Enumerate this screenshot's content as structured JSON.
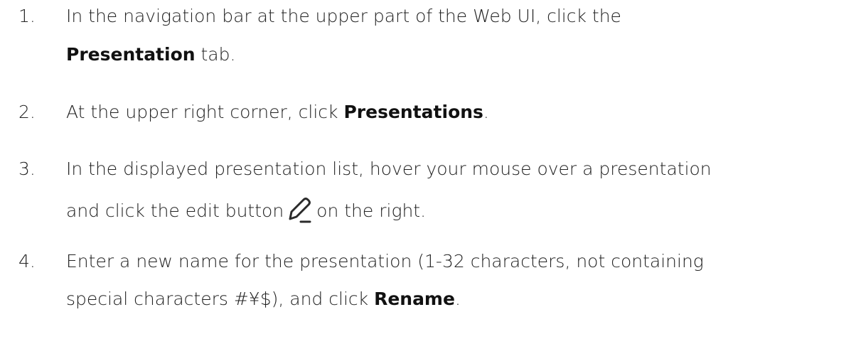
{
  "steps": [
    {
      "number": "1.",
      "text_a": "In the navigation bar at the upper part of the Web UI, click the",
      "bold_1": "Presentation",
      "text_b": " tab."
    },
    {
      "number": "2.",
      "text_a": "At the upper right corner, click ",
      "bold_1": "Presentations",
      "text_b": "."
    },
    {
      "number": "3.",
      "text_a": "In the displayed presentation list, hover your mouse over a presentation",
      "text_b": "and click the edit button",
      "text_c": "on the right.",
      "icon": "pencil-edit-icon"
    },
    {
      "number": "4.",
      "text_a": "Enter a new name for the presentation (1-32 characters, not containing",
      "text_b": "special characters #¥$), and click ",
      "bold_1": "Rename",
      "text_c": "."
    }
  ]
}
